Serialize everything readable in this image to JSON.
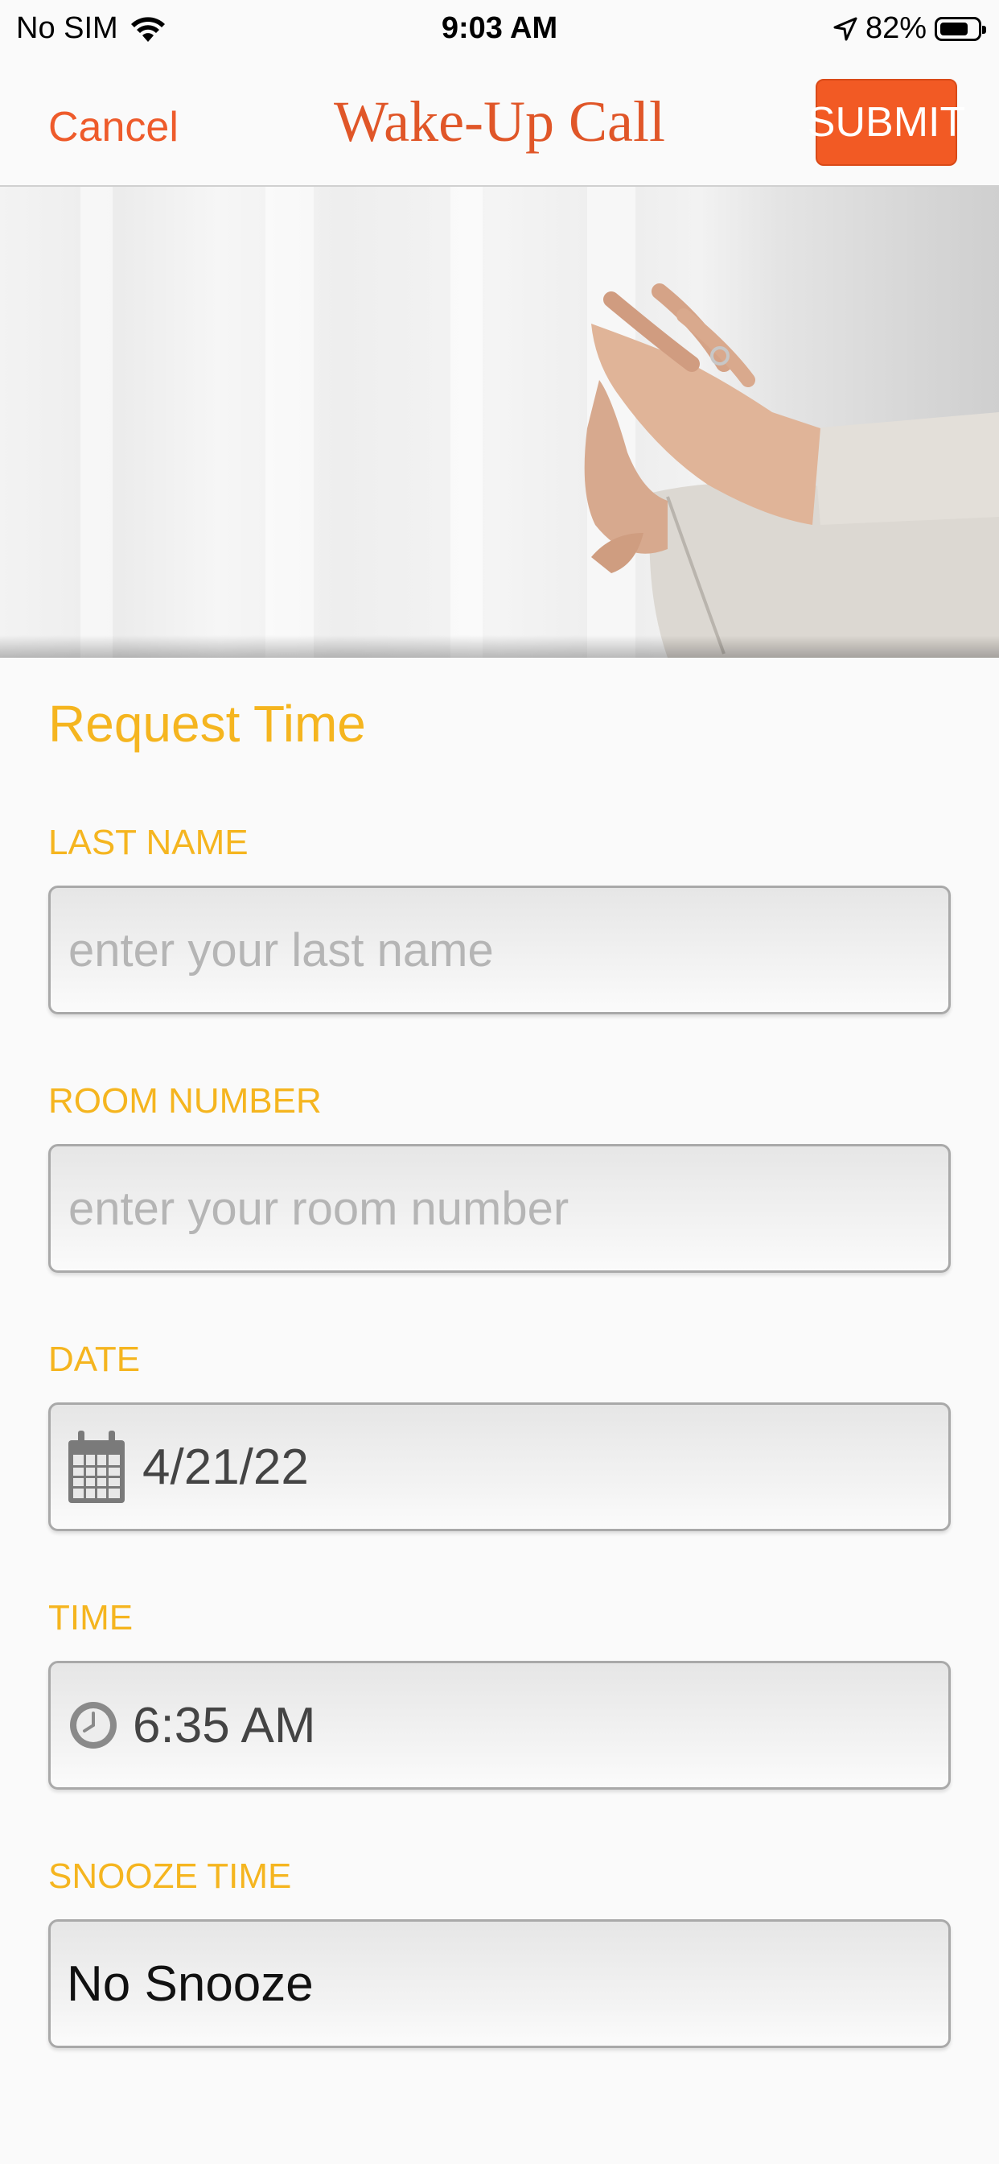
{
  "status_bar": {
    "carrier": "No SIM",
    "time": "9:03 AM",
    "battery_percent": "82%",
    "battery_level": 0.82
  },
  "nav": {
    "cancel_label": "Cancel",
    "title": "Wake-Up Call",
    "submit_label": "SUBMIT"
  },
  "form": {
    "section_title": "Request Time",
    "last_name": {
      "label": "LAST NAME",
      "placeholder": "enter your last name",
      "value": ""
    },
    "room_number": {
      "label": "ROOM NUMBER",
      "placeholder": "enter your room number",
      "value": ""
    },
    "date": {
      "label": "DATE",
      "value": "4/21/22",
      "icon": "calendar-icon"
    },
    "time": {
      "label": "TIME",
      "value": "6:35 AM",
      "icon": "clock-icon"
    },
    "snooze": {
      "label": "SNOOZE TIME",
      "value": "No Snooze"
    }
  },
  "colors": {
    "accent": "#f25a24",
    "title": "#e05628",
    "label": "#f5b51f"
  }
}
